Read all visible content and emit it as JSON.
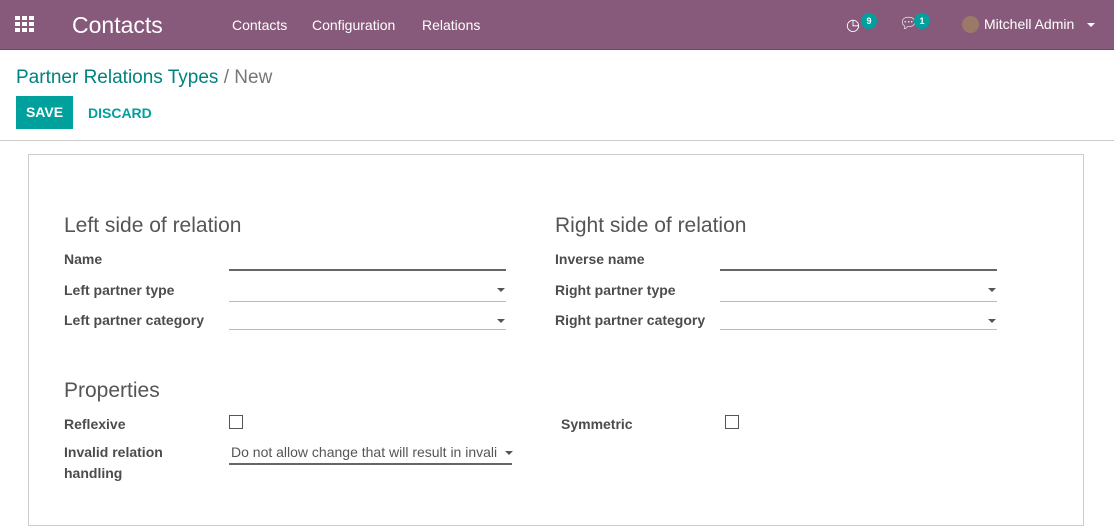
{
  "navbar": {
    "app_title": "Contacts",
    "menu": [
      "Contacts",
      "Configuration",
      "Relations"
    ],
    "activity_count": "9",
    "message_count": "1",
    "user": "Mitchell Admin",
    "color": "#875a7b"
  },
  "control": {
    "breadcrumb_parent": "Partner Relations Types",
    "breadcrumb_sep": "/",
    "breadcrumb_current": "New",
    "save_label": "SAVE",
    "discard_label": "DISCARD",
    "accent": "#00a09d"
  },
  "form": {
    "left_title": "Left side of relation",
    "right_title": "Right side of relation",
    "name_label": "Name",
    "name_value": "",
    "left_type_label": "Left partner type",
    "left_type_value": "",
    "left_cat_label": "Left partner category",
    "left_cat_value": "",
    "inverse_label": "Inverse name",
    "inverse_value": "",
    "right_type_label": "Right partner type",
    "right_type_value": "",
    "right_cat_label": "Right partner category",
    "right_cat_value": "",
    "properties_title": "Properties",
    "reflexive_label": "Reflexive",
    "reflexive_checked": false,
    "symmetric_label": "Symmetric",
    "symmetric_checked": false,
    "invalid_label": "Invalid relation handling",
    "invalid_value": "Do not allow change that will result in invali"
  }
}
